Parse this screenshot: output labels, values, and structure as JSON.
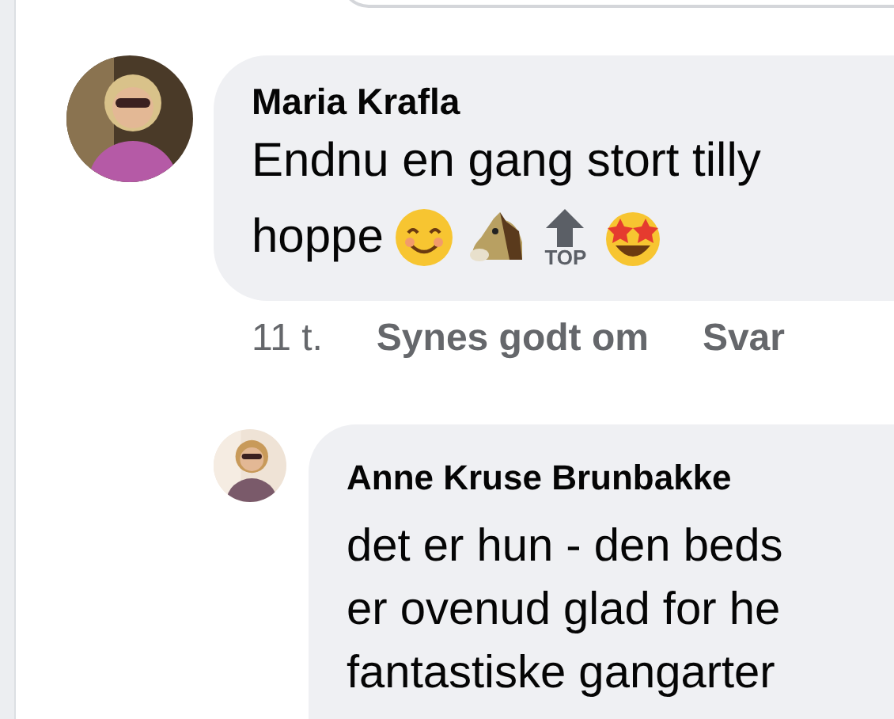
{
  "comments": [
    {
      "author": "Maria Krafla",
      "lines": [
        "Endnu en gang stort tilly",
        "hoppe"
      ],
      "top_label": "TOP",
      "time": "11 t.",
      "actions": [
        "Synes godt om",
        "Svar"
      ]
    },
    {
      "author": "Anne Kruse Brunbakke",
      "lines": [
        "det er hun - den beds",
        "er ovenud glad for he",
        "fantastiske gangarter"
      ]
    }
  ]
}
